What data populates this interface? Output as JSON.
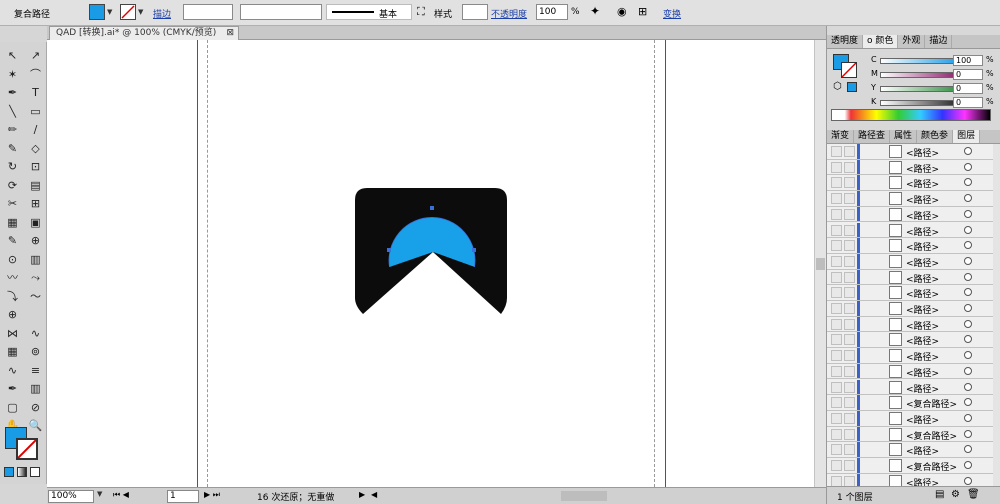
{
  "control_bar": {
    "selection_label": "复合路径",
    "stroke_label": "描边",
    "stroke_profile": "基本",
    "style_label": "样式",
    "opacity_label": "不透明度",
    "opacity_value": "100",
    "opacity_unit": "%",
    "transform_label": "变换",
    "fill_color": "#1a9be6"
  },
  "document": {
    "tab_title": "QAD [转换].ai* @ 100% (CMYK/预览)",
    "close_glyph": "⊠"
  },
  "artwork": {
    "dark_color": "#0c0c0c",
    "circle_color": "#18a0e8"
  },
  "tools": {
    "rows": [
      [
        "↖",
        "↗"
      ],
      [
        "✶",
        "⌒"
      ],
      [
        "✒",
        "T"
      ],
      [
        "╲",
        "▭"
      ],
      [
        "✏",
        "∕"
      ],
      [
        "✎",
        "◇"
      ],
      [
        "↻",
        "⊡"
      ],
      [
        "⟳",
        "▤"
      ],
      [
        "✂",
        "⊞"
      ],
      [
        "▦",
        "▣"
      ],
      [
        "✎",
        "⊕"
      ],
      [
        "⊙",
        "▥"
      ],
      [
        "〰",
        "⤳"
      ],
      [
        "⤵",
        "〜"
      ],
      [
        "⊕",
        ""
      ],
      [
        "⋈",
        "∿"
      ],
      [
        "▦",
        "⊚"
      ],
      [
        "∿",
        "≡"
      ],
      [
        "✒",
        "▥"
      ],
      [
        "▢",
        "⊘"
      ],
      [
        "✋",
        "🔍"
      ]
    ]
  },
  "color_panel": {
    "tabs": [
      "透明度",
      "o 颜色",
      "外观",
      "描边"
    ],
    "active_tab": 1,
    "sliders": [
      {
        "label": "C",
        "value": "100",
        "unit": "%",
        "bar": "#1a9be6"
      },
      {
        "label": "M",
        "value": "0",
        "unit": "%",
        "bar": "#8a1a6a"
      },
      {
        "label": "Y",
        "value": "0",
        "unit": "%",
        "bar": "#2f8f3f"
      },
      {
        "label": "K",
        "value": "0",
        "unit": "%",
        "bar": "#222222"
      }
    ]
  },
  "layers_panel": {
    "tabs": [
      "渐变",
      "路径查",
      "属性",
      "颜色参",
      "图层"
    ],
    "active_tab": 4,
    "rows": [
      {
        "name": "<路径>"
      },
      {
        "name": "<路径>"
      },
      {
        "name": "<路径>"
      },
      {
        "name": "<路径>"
      },
      {
        "name": "<路径>"
      },
      {
        "name": "<路径>"
      },
      {
        "name": "<路径>"
      },
      {
        "name": "<路径>"
      },
      {
        "name": "<路径>"
      },
      {
        "name": "<路径>"
      },
      {
        "name": "<路径>"
      },
      {
        "name": "<路径>"
      },
      {
        "name": "<路径>"
      },
      {
        "name": "<路径>"
      },
      {
        "name": "<路径>"
      },
      {
        "name": "<路径>"
      },
      {
        "name": "<复合路径>"
      },
      {
        "name": "<路径>"
      },
      {
        "name": "<复合路径>"
      },
      {
        "name": "<路径>"
      },
      {
        "name": "<复合路径>"
      },
      {
        "name": "<路径>"
      }
    ],
    "count_label": "1 个图层"
  },
  "status_bar": {
    "zoom": "100%",
    "page": "1",
    "status_text": "16 次还原；无重做"
  }
}
